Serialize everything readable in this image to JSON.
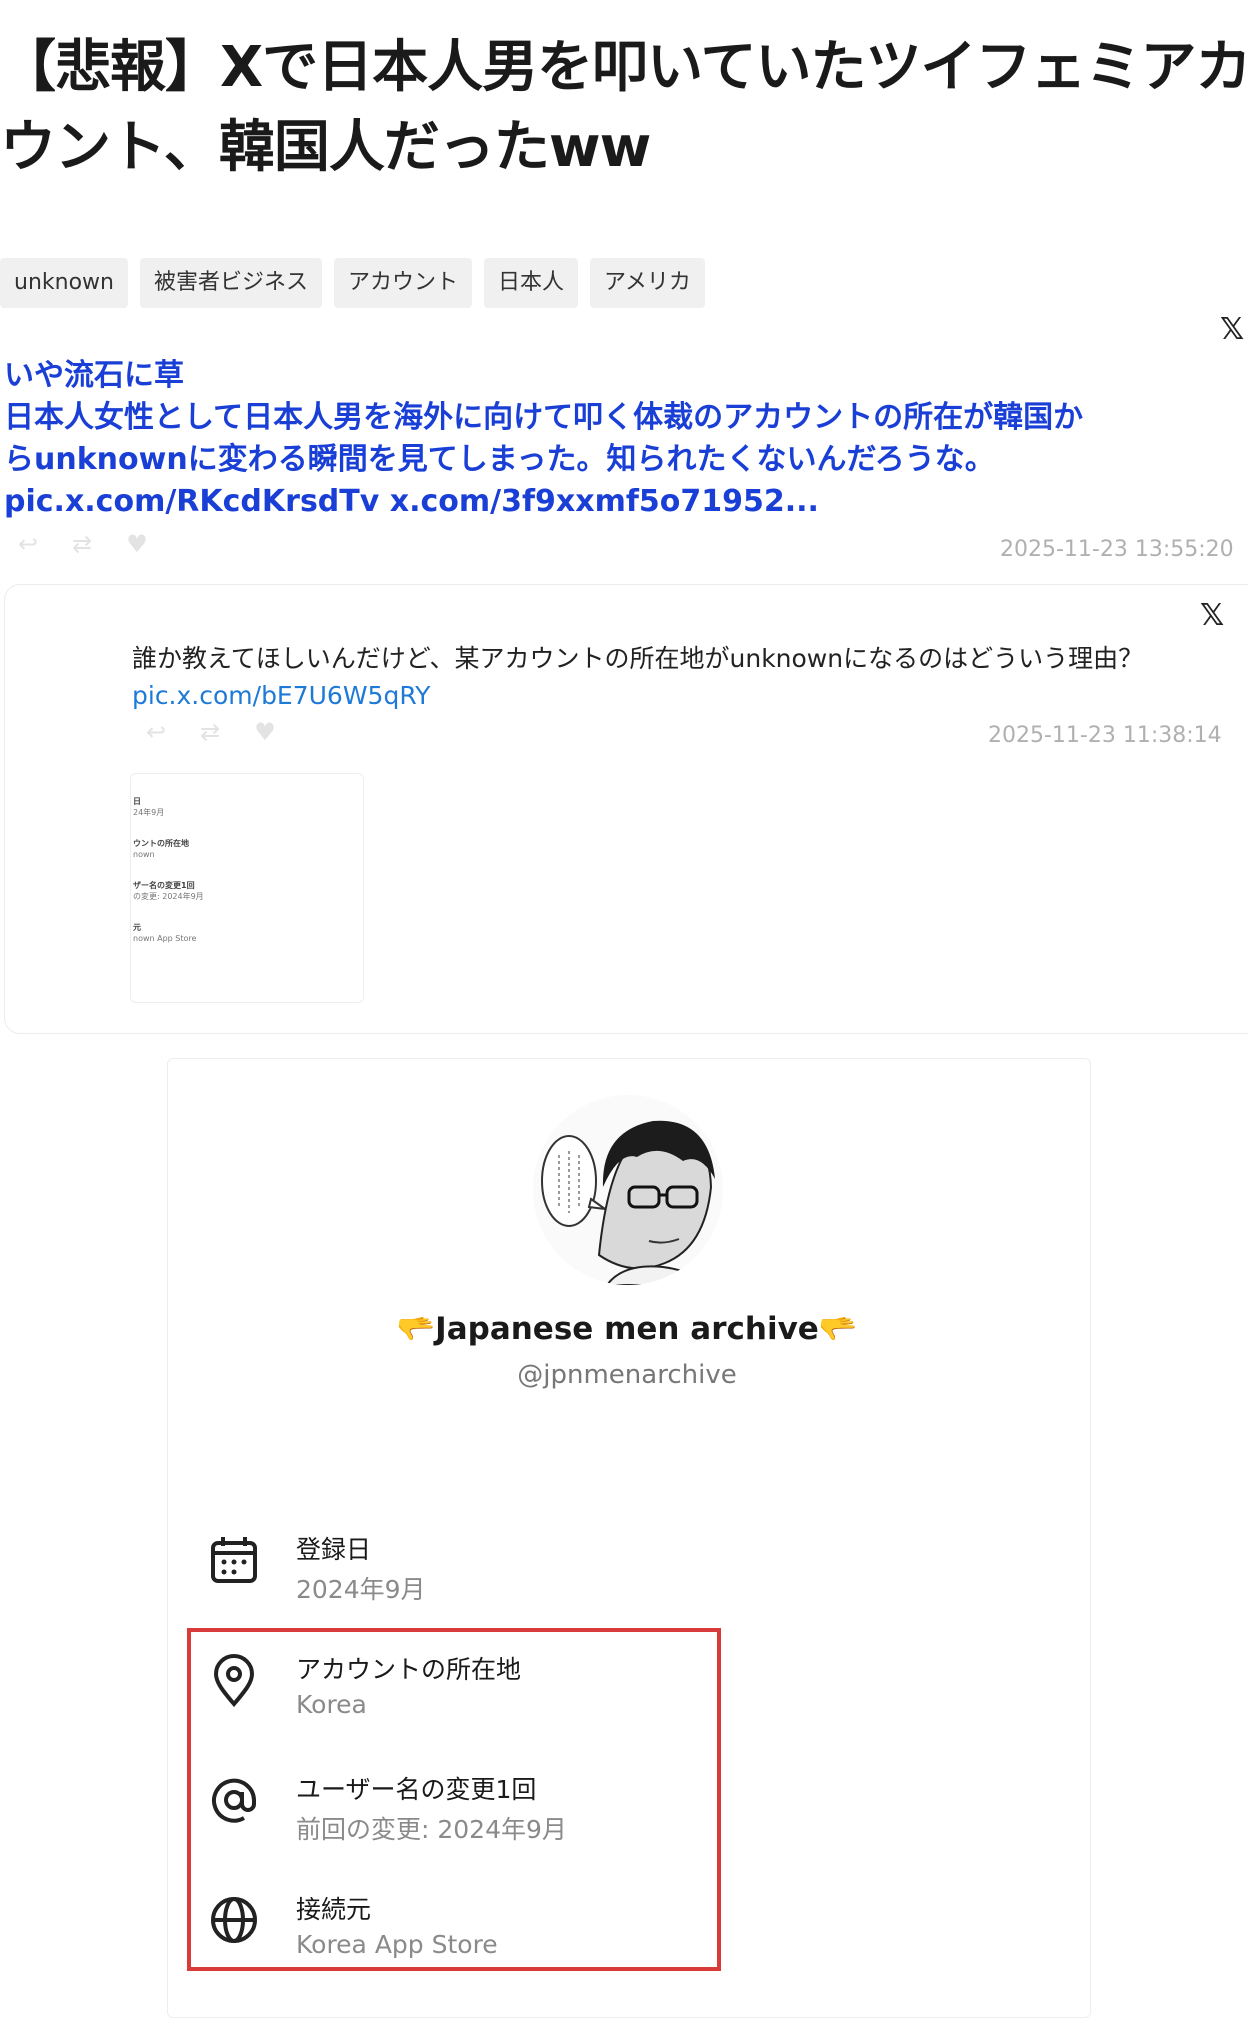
{
  "article": {
    "title_line1": "【悲報】Xで日本人男を叩いていたツイフェミアカ",
    "title_line2": "ウント、韓国人だったww"
  },
  "tags": [
    "unknown",
    "被害者ビジネス",
    "アカウント",
    "日本人",
    "アメリカ"
  ],
  "tweet": {
    "x_icon": "x-logo-icon",
    "line1": "いや流石に草",
    "line2": "日本人女性として日本人男を海外に向けて叩く体裁のアカウントの所在が韓国か",
    "line3": "らunknownに変わる瞬間を見てしまった。知られたくないんだろうな。",
    "links": "pic.x.com/RKcdKrsdTv x.com/3f9xxmf5o71952...",
    "timestamp": "2025-11-23 13:55:20"
  },
  "quoted_tweet": {
    "x_icon": "x-logo-icon",
    "text": "誰か教えてほしいんだけど、某アカウントの所在地がunknownになるのはどういう理由？",
    "link": "pic.x.com/bE7U6W5qRY",
    "timestamp": "2025-11-23 11:38:14",
    "thumbnail": {
      "b1_head": "日",
      "b1_val": "24年9月",
      "b2_head": "ウントの所在地",
      "b2_val": "nown",
      "b3_head": "ザー名の変更1回",
      "b3_val": "の変更: 2024年9月",
      "b4_head": "元",
      "b4_val": "nown App Store"
    }
  },
  "profile": {
    "display_name": "🫳Japanese men archive🫳",
    "handle": "@jpnmenarchive",
    "rows": [
      {
        "icon": "calendar-icon",
        "title": "登録日",
        "value": "2024年9月"
      },
      {
        "icon": "location-pin-icon",
        "title": "アカウントの所在地",
        "value": "Korea"
      },
      {
        "icon": "at-sign-icon",
        "title": "ユーザー名の変更1回",
        "value": "前回の変更: 2024年9月"
      },
      {
        "icon": "globe-icon",
        "title": "接続元",
        "value": "Korea App Store"
      }
    ],
    "highlight_color": "#d93a3a"
  },
  "colors": {
    "tweet_text": "#1a3fd6",
    "quote_link": "#1d7ad6",
    "timestamp": "#b0b0b0"
  }
}
